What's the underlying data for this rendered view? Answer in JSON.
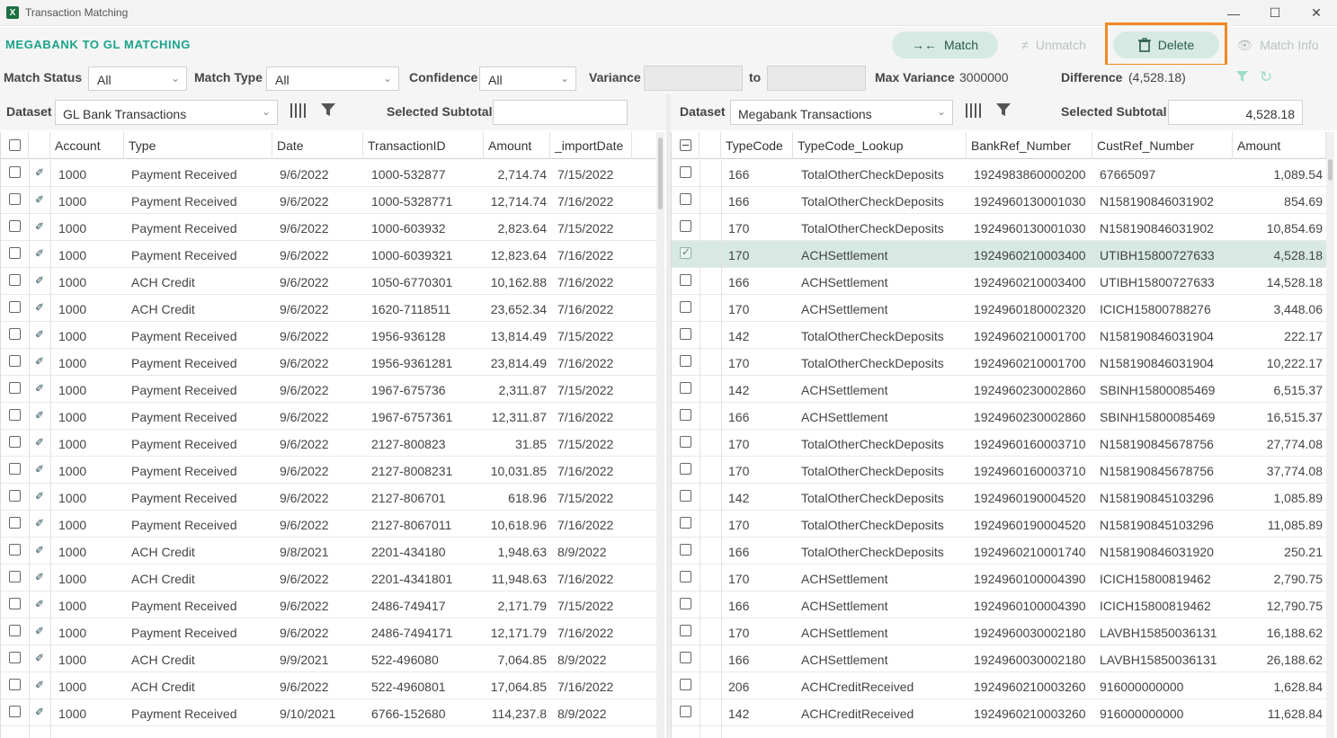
{
  "window": {
    "title": "Transaction Matching",
    "app_icon": "excel-icon"
  },
  "toolbar": {
    "brand": "MEGABANK TO GL MATCHING",
    "match_label": "Match",
    "unmatch_label": "Unmatch",
    "delete_label": "Delete",
    "match_info_label": "Match Info"
  },
  "filters": {
    "match_status_label": "Match Status",
    "match_status_value": "All",
    "match_type_label": "Match Type",
    "match_type_value": "All",
    "confidence_label": "Confidence",
    "confidence_value": "All",
    "variance_label": "Variance",
    "to_label": "to",
    "max_variance_label": "Max Variance",
    "max_variance_value": "3000000",
    "difference_label": "Difference",
    "difference_value": "(4,528.18)"
  },
  "left": {
    "dataset_label": "Dataset",
    "dataset_value": "GL Bank Transactions",
    "subtotal_label": "Selected Subtotal",
    "subtotal_value": "",
    "columns": [
      "Account",
      "Type",
      "Date",
      "TransactionID",
      "Amount",
      "_importDate"
    ],
    "rows": [
      [
        "1000",
        "Payment Received",
        "9/6/2022",
        "1000-532877",
        "2,714.74",
        "7/15/2022"
      ],
      [
        "1000",
        "Payment Received",
        "9/6/2022",
        "1000-5328771",
        "12,714.74",
        "7/16/2022"
      ],
      [
        "1000",
        "Payment Received",
        "9/6/2022",
        "1000-603932",
        "2,823.64",
        "7/15/2022"
      ],
      [
        "1000",
        "Payment Received",
        "9/6/2022",
        "1000-6039321",
        "12,823.64",
        "7/16/2022"
      ],
      [
        "1000",
        "ACH Credit",
        "9/6/2022",
        "1050-6770301",
        "10,162.88",
        "7/16/2022"
      ],
      [
        "1000",
        "ACH Credit",
        "9/6/2022",
        "1620-7118511",
        "23,652.34",
        "7/16/2022"
      ],
      [
        "1000",
        "Payment Received",
        "9/6/2022",
        "1956-936128",
        "13,814.49",
        "7/15/2022"
      ],
      [
        "1000",
        "Payment Received",
        "9/6/2022",
        "1956-9361281",
        "23,814.49",
        "7/16/2022"
      ],
      [
        "1000",
        "Payment Received",
        "9/6/2022",
        "1967-675736",
        "2,311.87",
        "7/15/2022"
      ],
      [
        "1000",
        "Payment Received",
        "9/6/2022",
        "1967-6757361",
        "12,311.87",
        "7/16/2022"
      ],
      [
        "1000",
        "Payment Received",
        "9/6/2022",
        "2127-800823",
        "31.85",
        "7/15/2022"
      ],
      [
        "1000",
        "Payment Received",
        "9/6/2022",
        "2127-8008231",
        "10,031.85",
        "7/16/2022"
      ],
      [
        "1000",
        "Payment Received",
        "9/6/2022",
        "2127-806701",
        "618.96",
        "7/15/2022"
      ],
      [
        "1000",
        "Payment Received",
        "9/6/2022",
        "2127-8067011",
        "10,618.96",
        "7/16/2022"
      ],
      [
        "1000",
        "ACH Credit",
        "9/8/2021",
        "2201-434180",
        "1,948.63",
        "8/9/2022"
      ],
      [
        "1000",
        "ACH Credit",
        "9/6/2022",
        "2201-4341801",
        "11,948.63",
        "7/16/2022"
      ],
      [
        "1000",
        "Payment Received",
        "9/6/2022",
        "2486-749417",
        "2,171.79",
        "7/15/2022"
      ],
      [
        "1000",
        "Payment Received",
        "9/6/2022",
        "2486-7494171",
        "12,171.79",
        "7/16/2022"
      ],
      [
        "1000",
        "ACH Credit",
        "9/9/2021",
        "522-496080",
        "7,064.85",
        "8/9/2022"
      ],
      [
        "1000",
        "ACH Credit",
        "9/6/2022",
        "522-4960801",
        "17,064.85",
        "7/16/2022"
      ],
      [
        "1000",
        "Payment Received",
        "9/10/2021",
        "6766-152680",
        "114,237.8",
        "8/9/2022"
      ]
    ]
  },
  "right": {
    "dataset_label": "Dataset",
    "dataset_value": "Megabank Transactions",
    "subtotal_label": "Selected Subtotal",
    "subtotal_value": "4,528.18",
    "columns": [
      "TypeCode",
      "TypeCode_Lookup",
      "BankRef_Number",
      "CustRef_Number",
      "Amount"
    ],
    "selected_row": 3,
    "rows": [
      [
        "166",
        "TotalOtherCheckDeposits",
        "1924983860000200",
        "67665097",
        "1,089.54"
      ],
      [
        "166",
        "TotalOtherCheckDeposits",
        "1924960130001030",
        "N158190846031902",
        "854.69"
      ],
      [
        "170",
        "TotalOtherCheckDeposits",
        "1924960130001030",
        "N158190846031902",
        "10,854.69"
      ],
      [
        "170",
        "ACHSettlement",
        "1924960210003400",
        "UTIBH15800727633",
        "4,528.18"
      ],
      [
        "166",
        "ACHSettlement",
        "1924960210003400",
        "UTIBH15800727633",
        "14,528.18"
      ],
      [
        "170",
        "ACHSettlement",
        "1924960180002320",
        "ICICH15800788276",
        "3,448.06"
      ],
      [
        "142",
        "TotalOtherCheckDeposits",
        "1924960210001700",
        "N158190846031904",
        "222.17"
      ],
      [
        "170",
        "TotalOtherCheckDeposits",
        "1924960210001700",
        "N158190846031904",
        "10,222.17"
      ],
      [
        "142",
        "ACHSettlement",
        "1924960230002860",
        "SBINH15800085469",
        "6,515.37"
      ],
      [
        "166",
        "ACHSettlement",
        "1924960230002860",
        "SBINH15800085469",
        "16,515.37"
      ],
      [
        "170",
        "TotalOtherCheckDeposits",
        "1924960160003710",
        "N158190845678756",
        "27,774.08"
      ],
      [
        "170",
        "TotalOtherCheckDeposits",
        "1924960160003710",
        "N158190845678756",
        "37,774.08"
      ],
      [
        "142",
        "TotalOtherCheckDeposits",
        "1924960190004520",
        "N158190845103296",
        "1,085.89"
      ],
      [
        "170",
        "TotalOtherCheckDeposits",
        "1924960190004520",
        "N158190845103296",
        "11,085.89"
      ],
      [
        "166",
        "TotalOtherCheckDeposits",
        "1924960210001740",
        "N158190846031920",
        "250.21"
      ],
      [
        "170",
        "ACHSettlement",
        "1924960100004390",
        "ICICH15800819462",
        "2,790.75"
      ],
      [
        "166",
        "ACHSettlement",
        "1924960100004390",
        "ICICH15800819462",
        "12,790.75"
      ],
      [
        "170",
        "ACHSettlement",
        "1924960030002180",
        "LAVBH15850036131",
        "16,188.62"
      ],
      [
        "166",
        "ACHSettlement",
        "1924960030002180",
        "LAVBH15850036131",
        "26,188.62"
      ],
      [
        "206",
        "ACHCreditReceived",
        "1924960210003260",
        "916000000000",
        "1,628.84"
      ],
      [
        "142",
        "ACHCreditReceived",
        "1924960210003260",
        "916000000000",
        "11,628.84"
      ]
    ]
  },
  "colors": {
    "brand": "#1aa38a",
    "button_bg": "#d6eae3",
    "selected_row": "#d7e9e2",
    "highlight_box": "#f08a24"
  }
}
